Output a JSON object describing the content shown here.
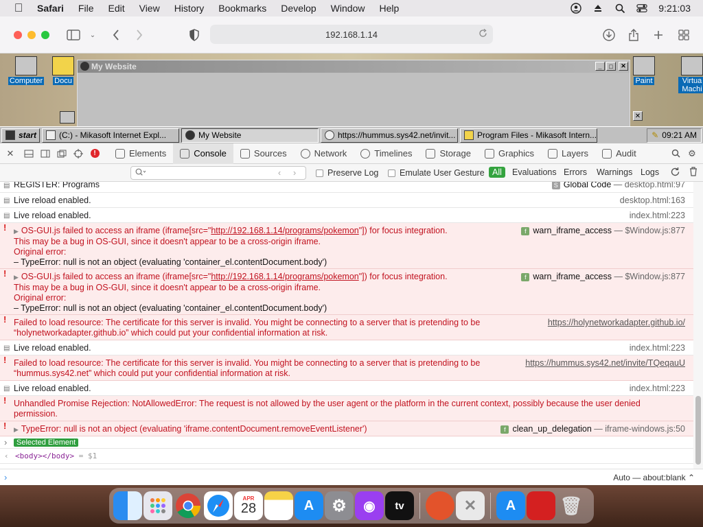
{
  "menubar": {
    "app": "Safari",
    "items": [
      "File",
      "Edit",
      "View",
      "History",
      "Bookmarks",
      "Develop",
      "Window",
      "Help"
    ],
    "clock": "9:21:03"
  },
  "browser": {
    "url": "192.168.1.14"
  },
  "desktop": {
    "icons_left": [
      "Computer",
      "Docu"
    ],
    "icons_right": [
      "Paint",
      "Virtua Machi"
    ],
    "window_title": "My Website"
  },
  "taskbar": {
    "start": "start",
    "buttons": [
      "(C:) - Mikasoft Internet Expl...",
      "My Website",
      "https://hummus.sys42.net/invit...",
      "Program Files - Mikasoft Intern..."
    ],
    "clock": "09:21 AM"
  },
  "devtools": {
    "tabs": [
      "Elements",
      "Console",
      "Sources",
      "Network",
      "Timelines",
      "Storage",
      "Graphics",
      "Layers",
      "Audit"
    ],
    "active_tab": "Console",
    "filter": {
      "preserve_log": "Preserve Log",
      "emulate": "Emulate User Gesture",
      "levels": [
        "All",
        "Evaluations",
        "Errors",
        "Warnings",
        "Logs"
      ]
    },
    "console": [
      {
        "type": "log",
        "text": "REGISTER: Programs",
        "fn": "Global Code",
        "src": "desktop.html:97"
      },
      {
        "type": "log",
        "text": "Live reload enabled.",
        "src": "desktop.html:163"
      },
      {
        "type": "log",
        "text": "Live reload enabled.",
        "src": "index.html:223"
      },
      {
        "type": "error",
        "l1a": "OS-GUI.js failed to access an iframe (iframe[src=\"",
        "l1link": "http://192.168.1.14/programs/pokemon",
        "l1b": "\"]) for focus integration.",
        "l2": "This may be a bug in OS-GUI, since it doesn't appear to be a cross-origin iframe.",
        "l3": "Original error:",
        "l4": "– TypeError: null is not an object (evaluating 'container_el.contentDocument.body')",
        "fn": "warn_iframe_access",
        "src": "$Window.js:877"
      },
      {
        "type": "error",
        "l1a": "OS-GUI.js failed to access an iframe (iframe[src=\"",
        "l1link": "http://192.168.1.14/programs/pokemon",
        "l1b": "\"]) for focus integration.",
        "l2": "This may be a bug in OS-GUI, since it doesn't appear to be a cross-origin iframe.",
        "l3": "Original error:",
        "l4": "– TypeError: null is not an object (evaluating 'container_el.contentDocument.body')",
        "fn": "warn_iframe_access",
        "src": "$Window.js:877"
      },
      {
        "type": "error",
        "l1": "Failed to load resource: The certificate for this server is invalid. You might be connecting to a server that is pretending to be",
        "l2": "“holynetworkadapter.github.io” which could put your confidential information at risk.",
        "src": "https://holynetworkadapter.github.io/"
      },
      {
        "type": "log",
        "text": "Live reload enabled.",
        "src": "index.html:223"
      },
      {
        "type": "error",
        "l1": "Failed to load resource: The certificate for this server is invalid. You might be connecting to a server that is pretending to be",
        "l2": "“hummus.sys42.net” which could put your confidential information at risk.",
        "src": "https://hummus.sys42.net/invite/TQeqauU"
      },
      {
        "type": "log",
        "text": "Live reload enabled.",
        "src": "index.html:223"
      },
      {
        "type": "error",
        "l1": "Unhandled Promise Rejection: NotAllowedError: The request is not allowed by the user agent or the platform in the current context, possibly because the user denied",
        "l2": "permission."
      },
      {
        "type": "error",
        "l1": "TypeError: null is not an object (evaluating 'iframe.contentDocument.removeEventListener')",
        "fn": "clean_up_delegation",
        "src": "iframe-windows.js:50"
      }
    ],
    "selected_element": "Selected Element",
    "selected_value": "<body></body>",
    "selected_var": "= $1",
    "context": "Auto — about:blank"
  },
  "dock": {
    "calendar_month": "APR",
    "calendar_day": "28",
    "tv_label": "tv"
  }
}
